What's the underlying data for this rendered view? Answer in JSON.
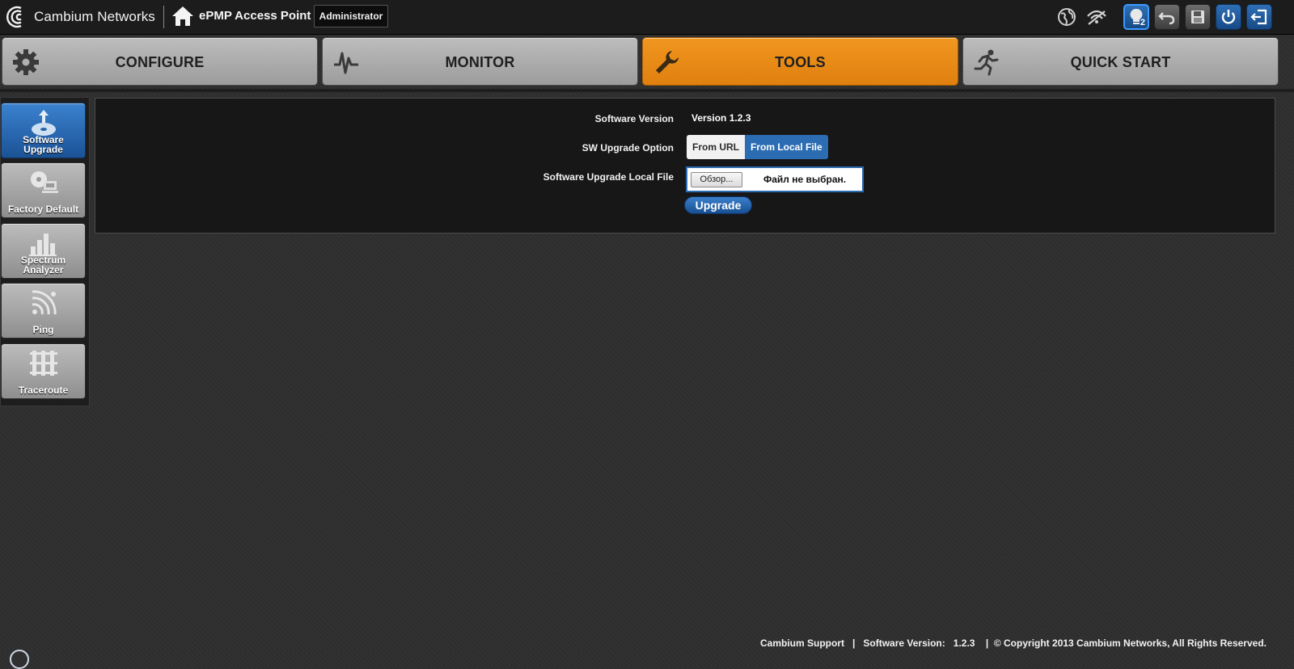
{
  "header": {
    "brand_name": "Cambium Networks",
    "product_name": "ePMP Access Point",
    "user_role": "Administrator",
    "notification_count": "2",
    "icons": [
      "globe-icon",
      "wireless-icon",
      "lightbulb-icon",
      "undo-icon",
      "save-icon",
      "power-icon",
      "logout-icon"
    ]
  },
  "tabs": [
    {
      "label": "CONFIGURE",
      "icon": "gear-icon",
      "active": false
    },
    {
      "label": "MONITOR",
      "icon": "pulse-icon",
      "active": false
    },
    {
      "label": "TOOLS",
      "icon": "wrench-icon",
      "active": true
    },
    {
      "label": "QUICK START",
      "icon": "running-man-icon",
      "active": false
    }
  ],
  "sidebar": {
    "items": [
      {
        "label_line1": "Software",
        "label_line2": "Upgrade",
        "icon": "upgrade-disc-icon",
        "active": true
      },
      {
        "label_line1": "Factory Default",
        "label_line2": "",
        "icon": "factory-reset-icon",
        "active": false
      },
      {
        "label_line1": "Spectrum",
        "label_line2": "Analyzer",
        "icon": "bar-chart-icon",
        "active": false
      },
      {
        "label_line1": "Ping",
        "label_line2": "",
        "icon": "signal-icon",
        "active": false
      },
      {
        "label_line1": "Traceroute",
        "label_line2": "",
        "icon": "network-grid-icon",
        "active": false
      }
    ]
  },
  "form": {
    "software_version_label": "Software Version",
    "software_version_value": "Version 1.2.3",
    "upgrade_option_label": "SW Upgrade Option",
    "option_url": "From URL",
    "option_local": "From Local File",
    "selected_option": "From Local File",
    "local_file_label": "Software Upgrade Local File",
    "browse_label": "Обзор...",
    "file_status": "Файл не выбран.",
    "upgrade_button": "Upgrade"
  },
  "footer": {
    "support_link": "Cambium Support",
    "separator": "|",
    "version_label": "Software Version:",
    "version_value": "1.2.3",
    "copyright": "© Copyright 2013 Cambium Networks, All Rights Reserved."
  },
  "colors": {
    "accent_orange": "#e88a18",
    "accent_blue": "#2b6cb3",
    "background": "#2e2e2e"
  }
}
